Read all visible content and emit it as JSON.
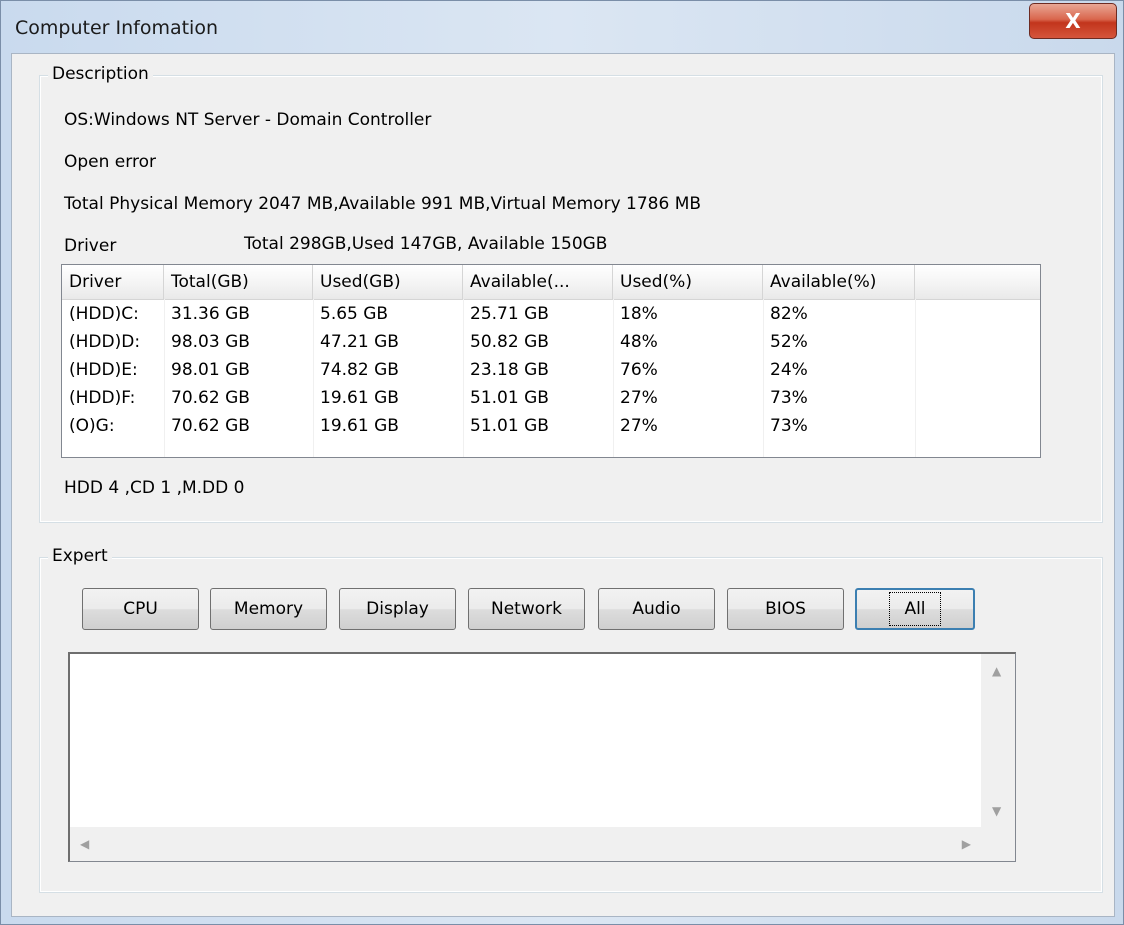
{
  "window": {
    "title": "Computer Infomation",
    "close_glyph": "X"
  },
  "description": {
    "legend": "Description",
    "os": "OS:Windows NT Server - Domain Controller",
    "status": "Open error",
    "memory": "Total Physical Memory 2047 MB,Available 991 MB,Virtual Memory 1786 MB",
    "driver_label": "Driver",
    "driver_summary": "Total 298GB,Used 147GB, Available 150GB",
    "table": {
      "headers": [
        "Driver",
        "Total(GB)",
        "Used(GB)",
        "Available(...",
        "Used(%)",
        "Available(%)"
      ],
      "rows": [
        [
          "(HDD)C:",
          "31.36 GB",
          "5.65 GB",
          "25.71 GB",
          "18%",
          "82%"
        ],
        [
          "(HDD)D:",
          "98.03 GB",
          "47.21 GB",
          "50.82 GB",
          "48%",
          "52%"
        ],
        [
          "(HDD)E:",
          "98.01 GB",
          "74.82 GB",
          "23.18 GB",
          "76%",
          "24%"
        ],
        [
          "(HDD)F:",
          "70.62 GB",
          "19.61 GB",
          "51.01 GB",
          "27%",
          "73%"
        ],
        [
          "(O)G:",
          "70.62 GB",
          "19.61 GB",
          "51.01 GB",
          "27%",
          "73%"
        ]
      ]
    },
    "counts": "HDD 4 ,CD 1 ,M.DD 0"
  },
  "expert": {
    "legend": "Expert",
    "buttons": [
      "CPU",
      "Memory",
      "Display",
      "Network",
      "Audio",
      "BIOS",
      "All"
    ],
    "output_text": ""
  },
  "icons": {
    "close": "close-icon",
    "scroll_up": "arrow-up-icon",
    "scroll_down": "arrow-down-icon",
    "scroll_left": "arrow-left-icon",
    "scroll_right": "arrow-right-icon"
  }
}
